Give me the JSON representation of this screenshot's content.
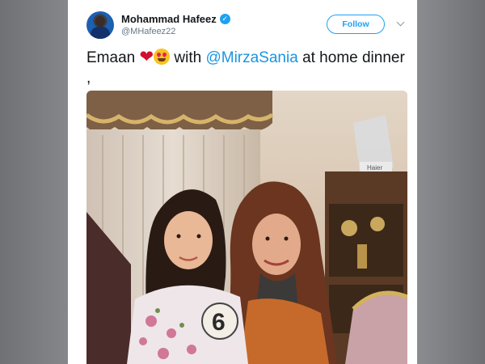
{
  "tweet": {
    "author_name": "Mohammad Hafeez",
    "author_handle": "@MHafeez22",
    "follow_label": "Follow",
    "text_part1": "Emaan",
    "heart_emoji": "❤",
    "text_with": "with",
    "mention": "@MirzaSania",
    "text_part2": "at home dinner ,",
    "verified_glyph": "✓"
  },
  "photo": {
    "sign_text": "Haier",
    "shirt_number": "6"
  },
  "colors": {
    "link": "#1b95e0",
    "follow": "#1da1f2",
    "name": "#14171a",
    "handle": "#657786"
  },
  "icons": [
    "verified-badge-icon",
    "chevron-down-icon",
    "heart-emoji-icon",
    "heart-eyes-emoji-icon"
  ]
}
